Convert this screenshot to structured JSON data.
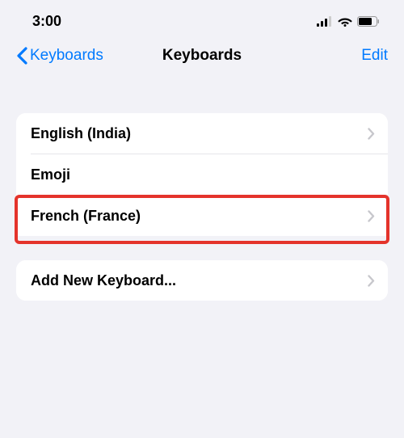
{
  "status": {
    "time": "3:00"
  },
  "nav": {
    "back_label": "Keyboards",
    "title": "Keyboards",
    "edit_label": "Edit"
  },
  "keyboards": {
    "items": [
      {
        "label": "English (India)",
        "has_disclosure": true
      },
      {
        "label": "Emoji",
        "has_disclosure": false
      },
      {
        "label": "French (France)",
        "has_disclosure": true
      }
    ],
    "highlighted_index": 2
  },
  "add": {
    "label": "Add New Keyboard..."
  },
  "colors": {
    "accent": "#007aff",
    "highlight": "#e4332b"
  }
}
